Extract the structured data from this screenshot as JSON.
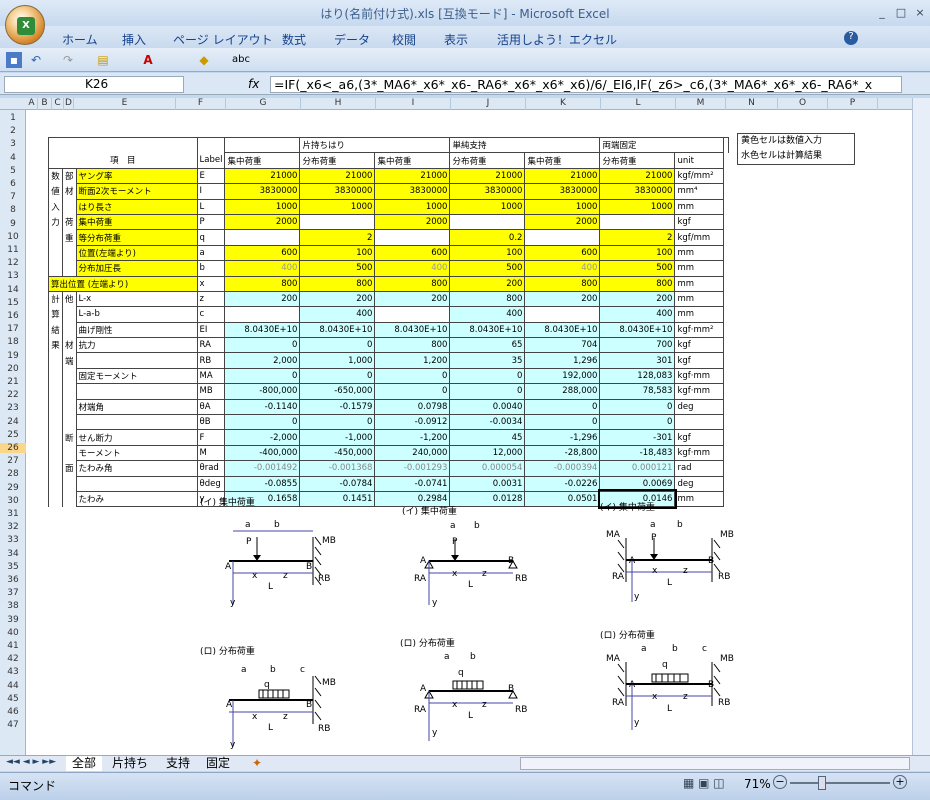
{
  "window": {
    "title": "はり(名前付け式).xls [互換モード] - Microsoft Excel",
    "min": "_",
    "restore": "□",
    "close": "×"
  },
  "ribbon": {
    "tabs": [
      "ホーム",
      "挿入",
      "ページ レイアウト",
      "数式",
      "データ",
      "校閲",
      "表示",
      "活用しよう！エクセル"
    ],
    "help": "?"
  },
  "formula_bar": {
    "name_box": "K26",
    "fx": "fx",
    "formula": "=IF(_x6<_a6,(3*_MA6*_x6*_x6-_RA6*_x6*_x6*_x6)/6/_EI6,IF(_z6>_c6,(3*_MA6*_x6*_x6-_RA6*_x"
  },
  "columns": [
    "A",
    "B",
    "C",
    "D",
    "E",
    "F",
    "G",
    "H",
    "I",
    "J",
    "K",
    "L",
    "M",
    "N",
    "O",
    "P"
  ],
  "rows": [
    "1",
    "2",
    "3",
    "4",
    "5",
    "6",
    "7",
    "8",
    "9",
    "10",
    "11",
    "12",
    "13",
    "14",
    "15",
    "16",
    "17",
    "18",
    "19",
    "20",
    "21",
    "22",
    "23",
    "24",
    "25",
    "26",
    "27",
    "28",
    "29",
    "30",
    "31",
    "32",
    "33",
    "34",
    "35",
    "36",
    "37",
    "38",
    "39",
    "40",
    "41",
    "42",
    "43",
    "44",
    "45",
    "46",
    "47"
  ],
  "legend": {
    "yellow": "黄色セルは数値入力",
    "cyan": "水色セルは計算結果"
  },
  "header": {
    "item": "項　目",
    "label": "Label",
    "cantilever": "片持ちはり",
    "simple": "単純支持",
    "fixed": "両端固定",
    "point": "集中荷重",
    "dist": "分布荷重",
    "unit": "unit"
  },
  "side": {
    "s1": "数",
    "s2": "値",
    "s3": "入",
    "s4": "力",
    "m1": "部",
    "m2": "材",
    "l1": "荷",
    "l2": "重",
    "k1": "計",
    "k2": "算",
    "k3": "結",
    "k4": "果",
    "o1": "他",
    "z1": "材",
    "z2": "端",
    "d1": "断",
    "d2": "面",
    "cal": "算出位置 (左端より)"
  },
  "rowsData": [
    {
      "name": "ヤング率",
      "label": "E",
      "v": [
        "21000",
        "21000",
        "21000",
        "21000",
        "21000",
        "21000"
      ],
      "unit": "kgf/mm²"
    },
    {
      "name": "断面2次モーメント",
      "label": "I",
      "v": [
        "3830000",
        "3830000",
        "3830000",
        "3830000",
        "3830000",
        "3830000"
      ],
      "unit": "mm⁴"
    },
    {
      "name": "はり長さ",
      "label": "L",
      "v": [
        "1000",
        "1000",
        "1000",
        "1000",
        "1000",
        "1000"
      ],
      "unit": "mm"
    },
    {
      "name": "集中荷重",
      "label": "P",
      "v": [
        "2000",
        "",
        "2000",
        "",
        "2000",
        ""
      ],
      "unit": "kgf"
    },
    {
      "name": "等分布荷重",
      "label": "q",
      "v": [
        "",
        "2",
        "",
        "0.2",
        "",
        "2"
      ],
      "unit": "kgf/mm"
    },
    {
      "name": "位置(左端より)",
      "label": "a",
      "v": [
        "600",
        "100",
        "600",
        "100",
        "600",
        "100"
      ],
      "unit": "mm"
    },
    {
      "name": "分布加圧長",
      "label": "b",
      "v": [
        "400",
        "500",
        "400",
        "500",
        "400",
        "500"
      ],
      "unit": "mm"
    },
    {
      "name": "",
      "label": "x",
      "v": [
        "800",
        "800",
        "800",
        "200",
        "800",
        "800"
      ],
      "unit": "mm"
    },
    {
      "name": "L-x",
      "label": "z",
      "v": [
        "200",
        "200",
        "200",
        "800",
        "200",
        "200"
      ],
      "unit": "mm"
    },
    {
      "name": "L-a-b",
      "label": "c",
      "v": [
        "",
        "400",
        "",
        "400",
        "",
        "400"
      ],
      "unit": "mm"
    },
    {
      "name": "曲げ剛性",
      "label": "EI",
      "v": [
        "8.0430E+10",
        "8.0430E+10",
        "8.0430E+10",
        "8.0430E+10",
        "8.0430E+10",
        "8.0430E+10"
      ],
      "unit": "kgf·mm²"
    },
    {
      "name": "抗力",
      "label": "RA",
      "v": [
        "0",
        "0",
        "800",
        "65",
        "704",
        "700"
      ],
      "unit": "kgf"
    },
    {
      "name": "",
      "label": "RB",
      "v": [
        "2,000",
        "1,000",
        "1,200",
        "35",
        "1,296",
        "301"
      ],
      "unit": "kgf"
    },
    {
      "name": "固定モーメント",
      "label": "MA",
      "v": [
        "0",
        "0",
        "0",
        "0",
        "192,000",
        "128,083"
      ],
      "unit": "kgf·mm"
    },
    {
      "name": "",
      "label": "MB",
      "v": [
        "-800,000",
        "-650,000",
        "0",
        "0",
        "288,000",
        "78,583"
      ],
      "unit": "kgf·mm"
    },
    {
      "name": "材端角",
      "label": "θA",
      "v": [
        "-0.1140",
        "-0.1579",
        "0.0798",
        "0.0040",
        "0",
        "0"
      ],
      "unit": "deg"
    },
    {
      "name": "",
      "label": "θB",
      "v": [
        "0",
        "0",
        "-0.0912",
        "-0.0034",
        "0",
        "0"
      ],
      "unit": ""
    },
    {
      "name": "せん断力",
      "label": "F",
      "v": [
        "-2,000",
        "-1,000",
        "-1,200",
        "45",
        "-1,296",
        "-301"
      ],
      "unit": "kgf"
    },
    {
      "name": "モーメント",
      "label": "M",
      "v": [
        "-400,000",
        "-450,000",
        "240,000",
        "12,000",
        "-28,800",
        "-18,483"
      ],
      "unit": "kgf·mm"
    },
    {
      "name": "たわみ角",
      "label": "θrad",
      "v": [
        "-0.001492",
        "-0.001368",
        "-0.001293",
        "0.000054",
        "-0.000394",
        "0.000121"
      ],
      "unit": "rad"
    },
    {
      "name": "",
      "label": "θdeg",
      "v": [
        "-0.0855",
        "-0.0784",
        "-0.0741",
        "0.0031",
        "-0.0226",
        "0.0069"
      ],
      "unit": "deg"
    },
    {
      "name": "たわみ",
      "label": "y",
      "v": [
        "0.1658",
        "0.1451",
        "0.2984",
        "0.0128",
        "0.0501",
        "0.0146"
      ],
      "unit": "mm"
    }
  ],
  "figs": {
    "a": "(イ) 集中荷重",
    "b": "(ロ) 分布荷重",
    "P": "P",
    "q": "q",
    "A": "A",
    "B": "B",
    "MA": "MA",
    "MB": "MB",
    "RA": "RA",
    "RB": "RB",
    "x": "x",
    "z": "z",
    "L": "L",
    "y": "y",
    "lab_a": "a",
    "lab_b": "b",
    "lab_c": "c"
  },
  "sheet_tabs": [
    "全部",
    "片持ち",
    "支持",
    "固定"
  ],
  "status": {
    "mode": "コマンド",
    "zoom": "71%"
  }
}
